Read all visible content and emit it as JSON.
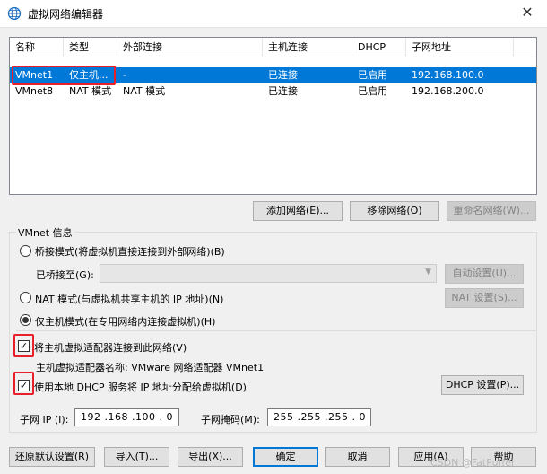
{
  "window": {
    "title": "虚拟网络编辑器",
    "close_glyph": "✕"
  },
  "table": {
    "headers": [
      "名称",
      "类型",
      "外部连接",
      "主机连接",
      "DHCP",
      "子网地址"
    ],
    "rows": [
      [
        "VMnet1",
        "仅主机...",
        "-",
        "已连接",
        "已启用",
        "192.168.100.0"
      ],
      [
        "VMnet8",
        "NAT 模式",
        "NAT 模式",
        "已连接",
        "已启用",
        "192.168.200.0"
      ]
    ],
    "selected_row": 0
  },
  "table_buttons": {
    "add": "添加网络(E)...",
    "remove": "移除网络(O)",
    "rename": "重命名网络(W)..."
  },
  "vmnet_info": {
    "label": "VMnet 信息",
    "bridge_mode": "桥接模式(将虚拟机直接连接到外部网络)(B)",
    "bridged_to_label": "已桥接至(G):",
    "bridged_to_value": "",
    "auto_settings": "自动设置(U)...",
    "nat_mode": "NAT 模式(与虚拟机共享主机的 IP 地址)(N)",
    "nat_settings": "NAT 设置(S)...",
    "host_only_mode": "仅主机模式(在专用网络内连接虚拟机)(H)",
    "connect_adapter": "将主机虚拟适配器连接到此网络(V)",
    "adapter_name": "主机虚拟适配器名称: VMware 网络适配器 VMnet1",
    "use_dhcp": "使用本地 DHCP 服务将 IP 地址分配给虚拟机(D)",
    "dhcp_settings": "DHCP 设置(P)...",
    "subnet_ip_label": "子网 IP (I):",
    "subnet_ip_value": "192 .168 .100 . 0",
    "subnet_mask_label": "子网掩码(M):",
    "subnet_mask_value": "255 .255 .255 . 0",
    "check_glyph": "✓"
  },
  "footer": {
    "restore": "还原默认设置(R)",
    "import": "导入(T)...",
    "export": "导出(X)...",
    "ok": "确定",
    "cancel": "取消",
    "apply": "应用(A)",
    "help": "帮助"
  },
  "watermark": "CSDN @FatPuffer",
  "colors": {
    "selection": "#0078d7",
    "highlight_box": "#e8202a",
    "window_bg": "#f0f0f0"
  }
}
